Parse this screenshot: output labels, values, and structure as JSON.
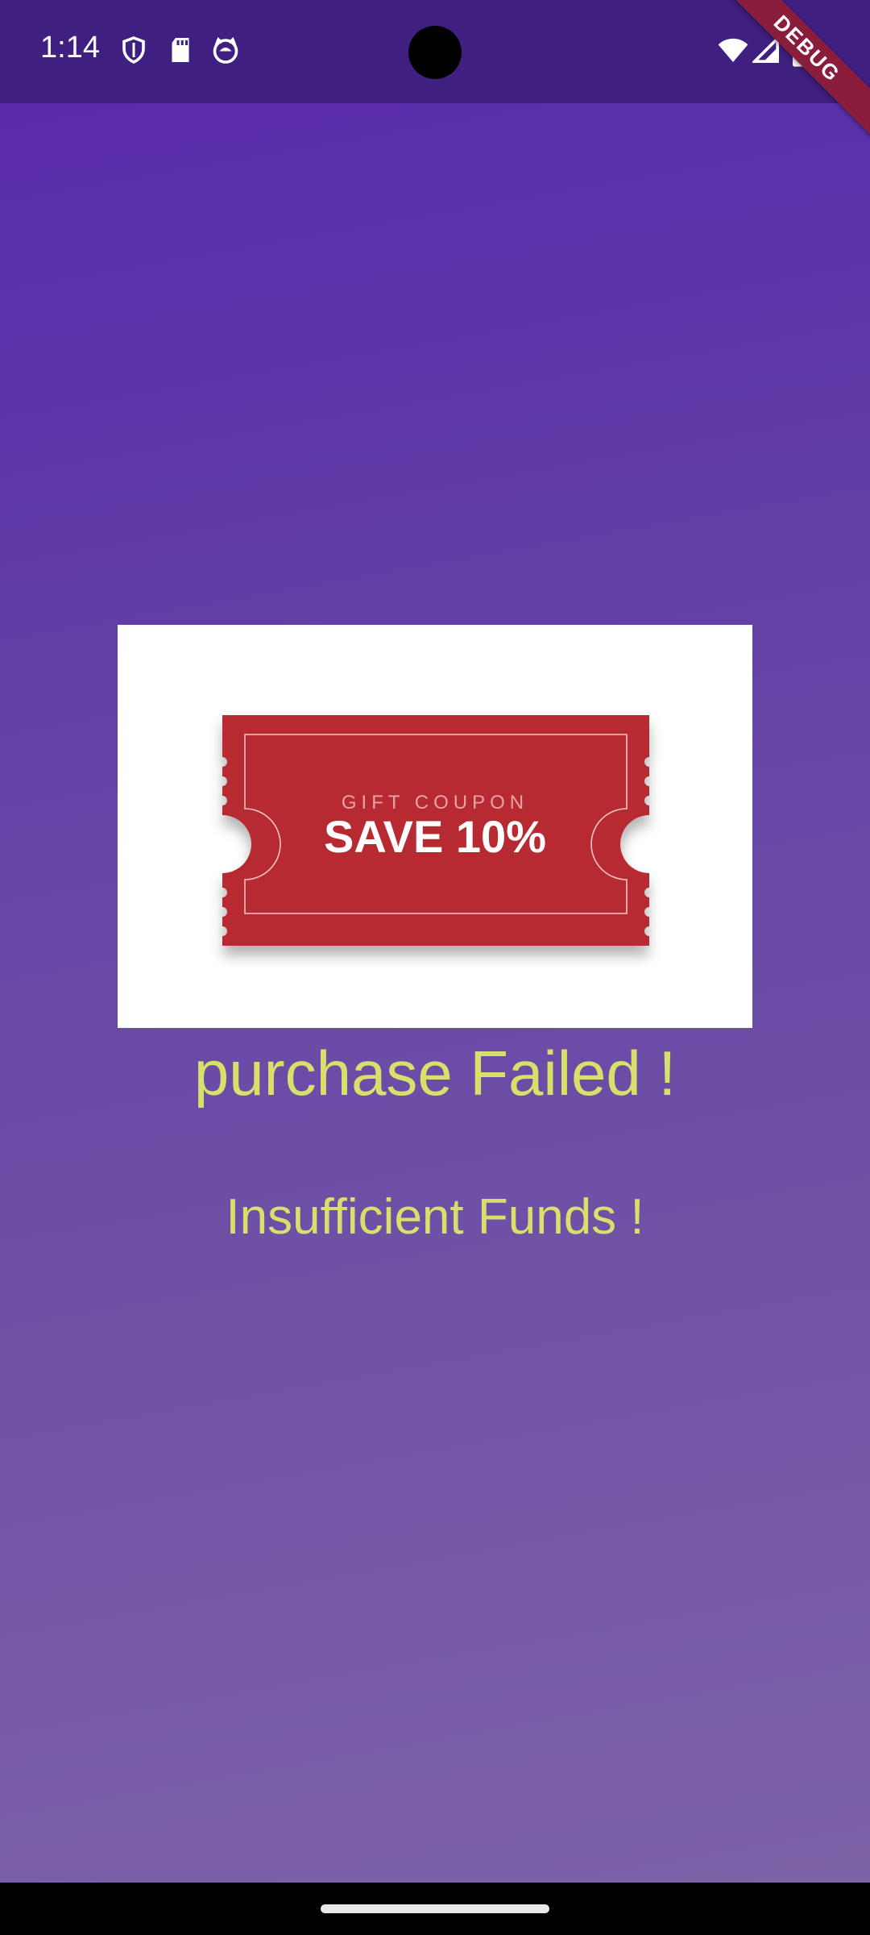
{
  "status_bar": {
    "time": "1:14",
    "left_icons": [
      "shield-icon",
      "sd-card-icon",
      "cat-face-icon"
    ],
    "right_icons": [
      "wifi-icon",
      "signal-icon",
      "battery-icon"
    ],
    "debug_banner": "DEBUG",
    "debug_color": "#8b1d3c"
  },
  "coupon": {
    "small_text": "GIFT COUPON",
    "big_text": "SAVE 10%",
    "color": "#b72a32"
  },
  "message": {
    "title": "purchase Failed !",
    "subtitle": "Insufficient Funds !",
    "text_color": "#d6e06a"
  },
  "background": {
    "gradient_start": "#5726ad",
    "gradient_end": "#7c62a7"
  }
}
